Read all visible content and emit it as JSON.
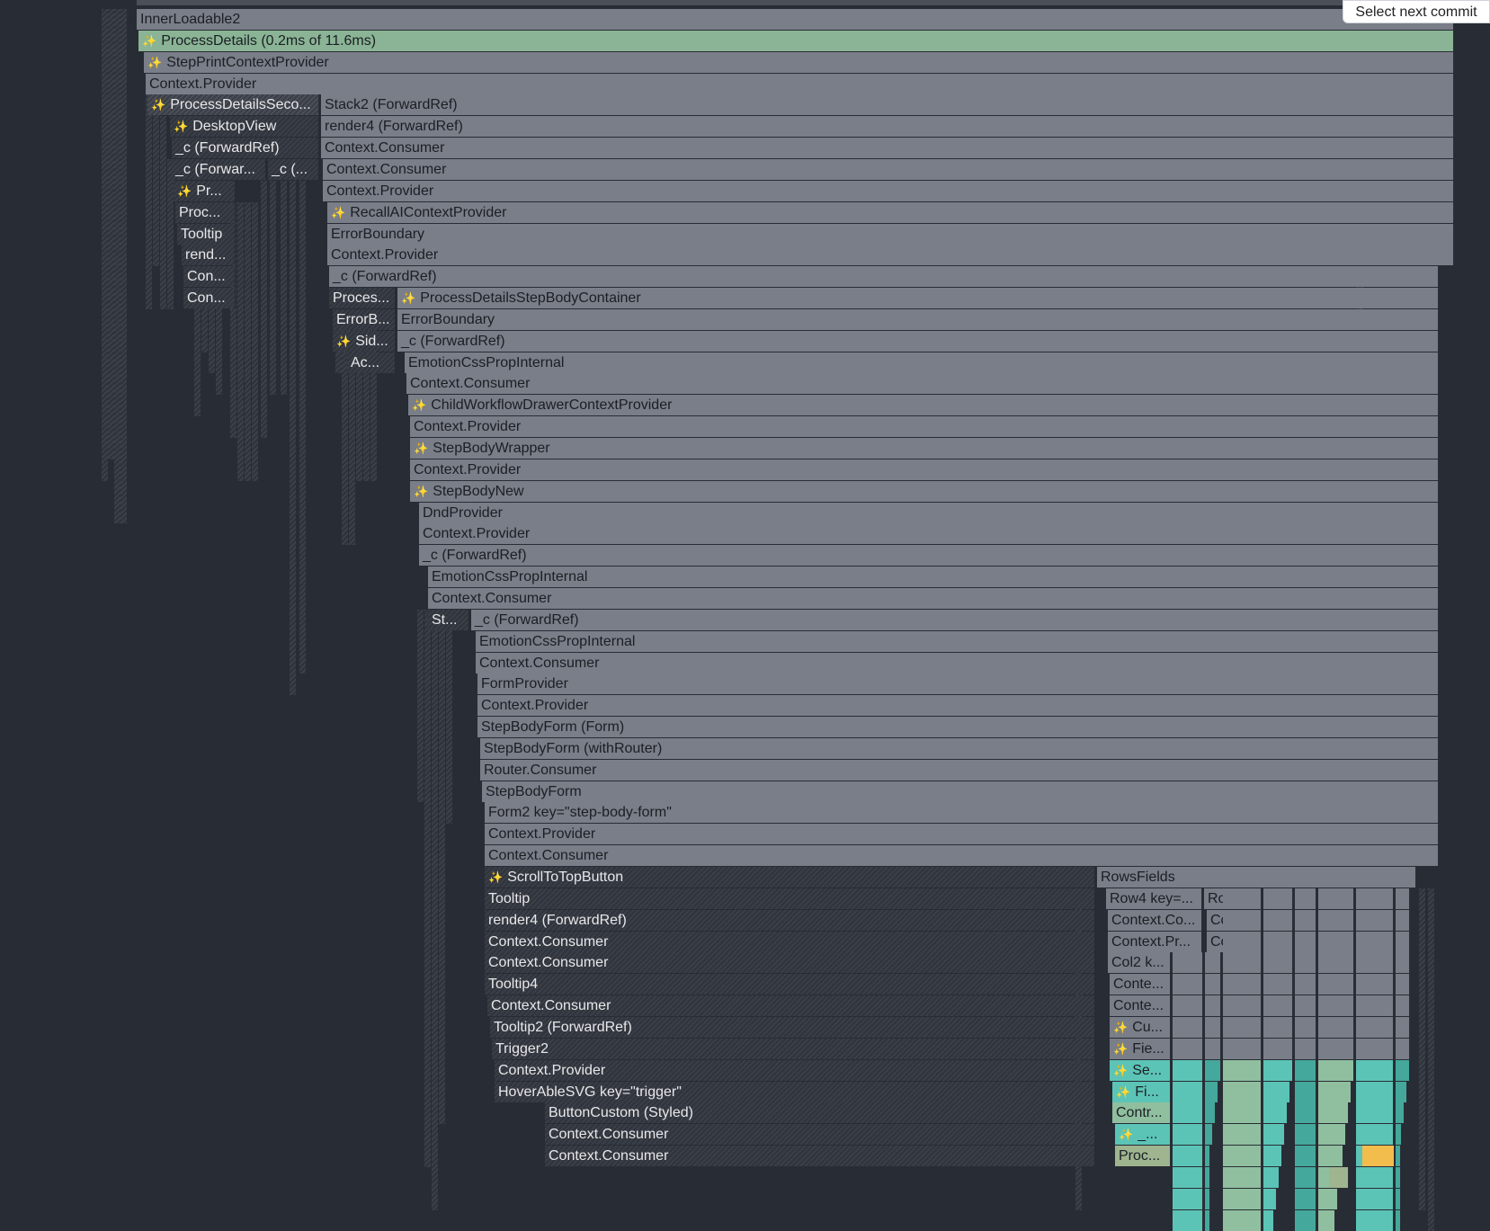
{
  "toolbar": {
    "select_next_commit": "Select next commit"
  },
  "icons": {
    "sparkle": "sparkle-icon"
  },
  "colors": {
    "background": "#282c34",
    "selected_node": "#8ab495",
    "unchanged_node": "#7a7e88",
    "rendered_fast": "#5cc4b6",
    "rendered_slow": "#f3bd4e"
  },
  "nodes": [
    {
      "label": "InnerLoadable2",
      "sparkle": false
    },
    {
      "label": "ProcessDetails (0.2ms of 11.6ms)",
      "sparkle": true
    },
    {
      "label": "StepPrintContextProvider",
      "sparkle": true
    },
    {
      "label": "Context.Provider",
      "sparkle": false
    },
    {
      "label": "ProcessDetailsSeco...",
      "sparkle": true
    },
    {
      "label": "Stack2 (ForwardRef)",
      "sparkle": false
    },
    {
      "label": "DesktopView",
      "sparkle": true
    },
    {
      "label": "render4 (ForwardRef)",
      "sparkle": false
    },
    {
      "label": "_c (ForwardRef)",
      "sparkle": false
    },
    {
      "label": "Context.Consumer",
      "sparkle": false
    },
    {
      "label": "_c (Forwar...",
      "sparkle": false
    },
    {
      "label": "_c (...",
      "sparkle": false
    },
    {
      "label": "Context.Consumer",
      "sparkle": false
    },
    {
      "label": "Pr...",
      "sparkle": true
    },
    {
      "label": "Context.Provider",
      "sparkle": false
    },
    {
      "label": "Proc...",
      "sparkle": false
    },
    {
      "label": "RecallAIContextProvider",
      "sparkle": true
    },
    {
      "label": "Tooltip",
      "sparkle": false
    },
    {
      "label": "ErrorBoundary",
      "sparkle": false
    },
    {
      "label": "rend...",
      "sparkle": false
    },
    {
      "label": "Context.Provider",
      "sparkle": false
    },
    {
      "label": "Con...",
      "sparkle": false
    },
    {
      "label": "_c (ForwardRef)",
      "sparkle": false
    },
    {
      "label": "Con...",
      "sparkle": false
    },
    {
      "label": "Proces...",
      "sparkle": false
    },
    {
      "label": "ProcessDetailsStepBodyContainer",
      "sparkle": true
    },
    {
      "label": "ErrorB...",
      "sparkle": false
    },
    {
      "label": "ErrorBoundary",
      "sparkle": false
    },
    {
      "label": "Sid...",
      "sparkle": true
    },
    {
      "label": "_c (ForwardRef)",
      "sparkle": false
    },
    {
      "label": "Ac...",
      "sparkle": false
    },
    {
      "label": "EmotionCssPropInternal",
      "sparkle": false
    },
    {
      "label": "Context.Consumer",
      "sparkle": false
    },
    {
      "label": "ChildWorkflowDrawerContextProvider",
      "sparkle": true
    },
    {
      "label": "Context.Provider",
      "sparkle": false
    },
    {
      "label": "StepBodyWrapper",
      "sparkle": true
    },
    {
      "label": "Context.Provider",
      "sparkle": false
    },
    {
      "label": "StepBodyNew",
      "sparkle": true
    },
    {
      "label": "DndProvider",
      "sparkle": false
    },
    {
      "label": "Context.Provider",
      "sparkle": false
    },
    {
      "label": "_c (ForwardRef)",
      "sparkle": false
    },
    {
      "label": "EmotionCssPropInternal",
      "sparkle": false
    },
    {
      "label": "Context.Consumer",
      "sparkle": false
    },
    {
      "label": "St...",
      "sparkle": false
    },
    {
      "label": "_c (ForwardRef)",
      "sparkle": false
    },
    {
      "label": "EmotionCssPropInternal",
      "sparkle": false
    },
    {
      "label": "Context.Consumer",
      "sparkle": false
    },
    {
      "label": "FormProvider",
      "sparkle": false
    },
    {
      "label": "Context.Provider",
      "sparkle": false
    },
    {
      "label": "StepBodyForm (Form)",
      "sparkle": false
    },
    {
      "label": "StepBodyForm (withRouter)",
      "sparkle": false
    },
    {
      "label": "Router.Consumer",
      "sparkle": false
    },
    {
      "label": "StepBodyForm",
      "sparkle": false
    },
    {
      "label": "Form2 key=\"step-body-form\"",
      "sparkle": false
    },
    {
      "label": "Context.Provider",
      "sparkle": false
    },
    {
      "label": "Context.Consumer",
      "sparkle": false
    },
    {
      "label": "ScrollToTopButton",
      "sparkle": true
    },
    {
      "label": "RowsFields",
      "sparkle": false
    },
    {
      "label": "Tooltip",
      "sparkle": false
    },
    {
      "label": "Row4 key=...",
      "sparkle": false
    },
    {
      "label": "Row...",
      "sparkle": false
    },
    {
      "label": "render4 (ForwardRef)",
      "sparkle": false
    },
    {
      "label": "Context.Co...",
      "sparkle": false
    },
    {
      "label": "Cont...",
      "sparkle": false
    },
    {
      "label": "Context.Consumer",
      "sparkle": false
    },
    {
      "label": "Context.Pr...",
      "sparkle": false
    },
    {
      "label": "Cont...",
      "sparkle": false
    },
    {
      "label": "Context.Consumer",
      "sparkle": false
    },
    {
      "label": "Col2 k...",
      "sparkle": false
    },
    {
      "label": "Tooltip4",
      "sparkle": false
    },
    {
      "label": "Conte...",
      "sparkle": false
    },
    {
      "label": "Context.Consumer",
      "sparkle": false
    },
    {
      "label": "Conte...",
      "sparkle": false
    },
    {
      "label": "Tooltip2 (ForwardRef)",
      "sparkle": false
    },
    {
      "label": "Cu...",
      "sparkle": true
    },
    {
      "label": "Trigger2",
      "sparkle": false
    },
    {
      "label": "Fie...",
      "sparkle": true
    },
    {
      "label": "Context.Provider",
      "sparkle": false
    },
    {
      "label": "Se...",
      "sparkle": true
    },
    {
      "label": "HoverAbleSVG key=\"trigger\"",
      "sparkle": false
    },
    {
      "label": "Fi...",
      "sparkle": true
    },
    {
      "label": "ButtonCustom (Styled)",
      "sparkle": false
    },
    {
      "label": "Contr...",
      "sparkle": false
    },
    {
      "label": "Context.Consumer",
      "sparkle": false
    },
    {
      "label": "_...",
      "sparkle": true
    },
    {
      "label": "Context.Consumer",
      "sparkle": false
    },
    {
      "label": "Proc...",
      "sparkle": false
    }
  ]
}
